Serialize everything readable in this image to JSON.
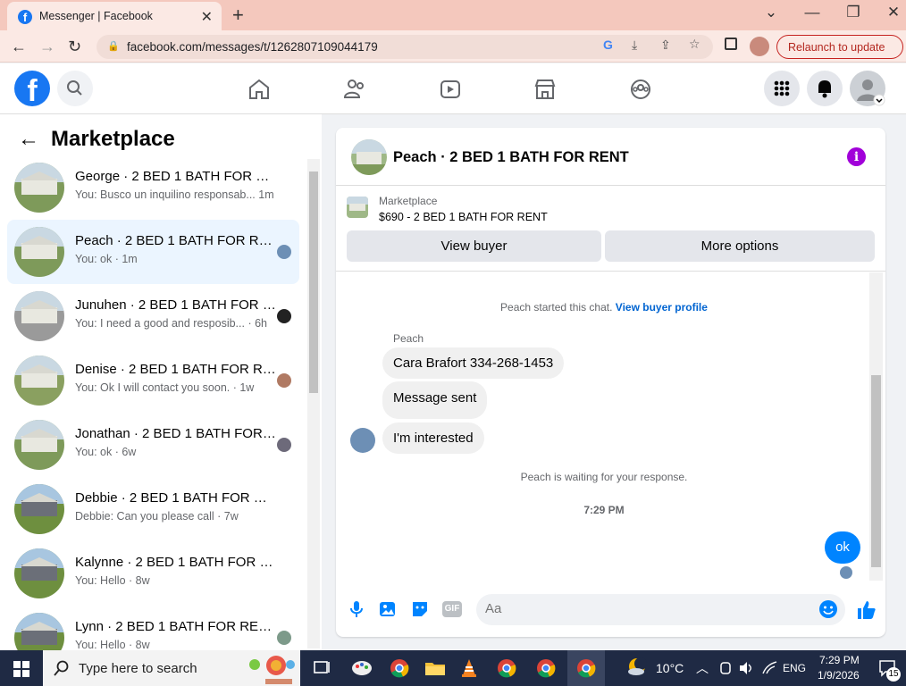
{
  "browser": {
    "tab_title": "Messenger | Facebook",
    "tab_close": "✕",
    "new_tab": "+",
    "url": "facebook.com/messages/t/1262807109044179",
    "relaunch_label": "Relaunch to update",
    "window_controls": [
      "⌄",
      "—",
      "❐",
      "✕"
    ]
  },
  "left_panel": {
    "title": "Marketplace",
    "conversations": [
      {
        "name": "George · 2 BED 1 BATH FOR RENT",
        "preview": "You: Busco un inquilino responsab... ",
        "time": "1m",
        "active": false
      },
      {
        "name": "Peach · 2 BED 1 BATH FOR RENT",
        "preview": "You: ok · 1m",
        "time": "",
        "active": true
      },
      {
        "name": "Junuhen · 2 BED 1 BATH FOR RENT",
        "preview": "You: I need a good and resposib... · ",
        "time": "6h",
        "active": false
      },
      {
        "name": "Denise · 2 BED 1 BATH FOR RENT",
        "preview": "You: Ok I will contact you soon. · 1w",
        "time": "",
        "active": false
      },
      {
        "name": "Jonathan · 2 BED 1 BATH FOR RENT",
        "preview": "You: ok · 6w",
        "time": "",
        "active": false
      },
      {
        "name": "Debbie · 2 BED 1 BATH FOR RENT",
        "preview": "Debbie: Can you please call · 7w",
        "time": "",
        "active": false
      },
      {
        "name": "Kalynne · 2 BED 1 BATH FOR RENT",
        "preview": "You: Hello · 8w",
        "time": "",
        "active": false
      },
      {
        "name": "Lynn · 2 BED 1 BATH FOR RENT",
        "preview": "You: Hello · 8w",
        "time": "",
        "active": false
      }
    ]
  },
  "chat": {
    "header_title": "Peach · 2 BED 1 BATH FOR RENT",
    "marketplace_label": "Marketplace",
    "listing": "$690 - 2 BED 1 BATH FOR RENT",
    "view_buyer": "View buyer",
    "more_options": "More options",
    "started": "Peach started this chat.",
    "view_profile": "View buyer profile",
    "sender": "Peach",
    "messages": [
      "Cara Brafort 334-268-1453",
      "Message sent",
      "I'm interested"
    ],
    "waiting": "Peach is waiting for your response.",
    "timestamp": "7:29 PM",
    "my_message": "ok",
    "composer_placeholder": "Aa",
    "gif_label": "GIF"
  },
  "taskbar": {
    "search_placeholder": "Type here to search",
    "weather": "10°C",
    "language": "ENG",
    "time": "7:29 PM",
    "date": "1/9/2026",
    "notifications": "15"
  },
  "colors": {
    "fb_blue": "#1877f2",
    "messenger_blue": "#0084ff",
    "info_purple": "#a100d9"
  }
}
